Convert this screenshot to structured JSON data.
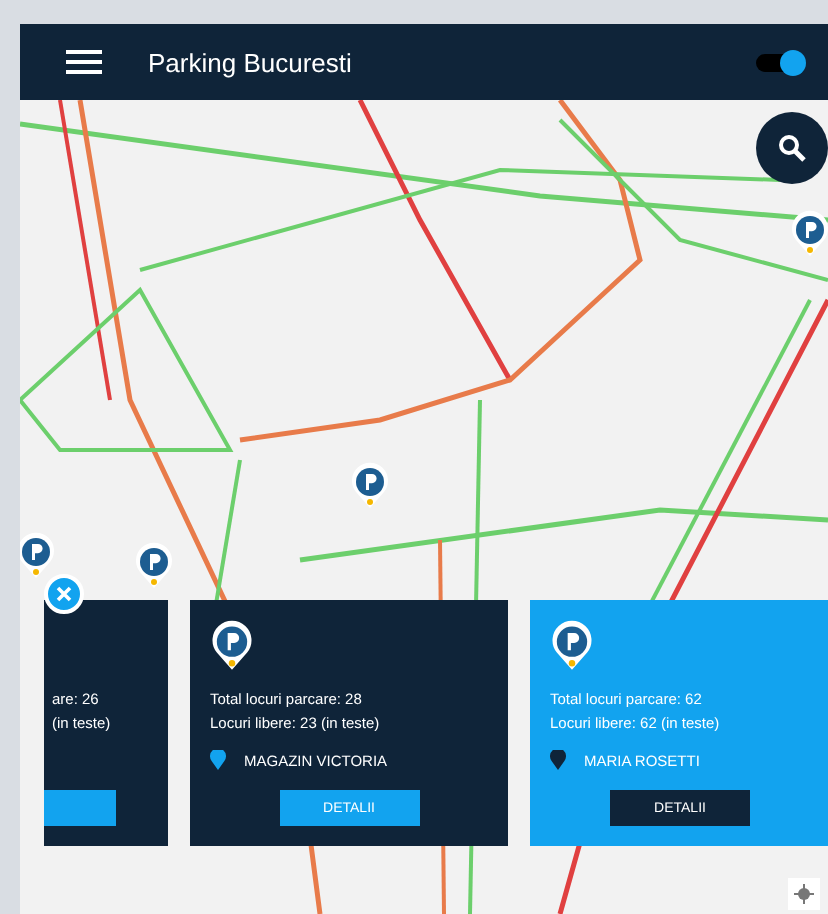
{
  "app_bar": {
    "title": "Parking Bucuresti",
    "toggle_on": true
  },
  "cards": [
    {
      "selected": false,
      "total": "are: 26",
      "free": "(in teste)"
    },
    {
      "selected": false,
      "total": "Total locuri parcare: 28",
      "free": "Locuri libere: 23 (in teste)",
      "name": "MAGAZIN VICTORIA",
      "button": "DETALII"
    },
    {
      "selected": true,
      "total": "Total locuri parcare: 62",
      "free": "Locuri libere: 62 (in teste)",
      "name": "MARIA ROSETTI",
      "button": "DETALII"
    }
  ]
}
